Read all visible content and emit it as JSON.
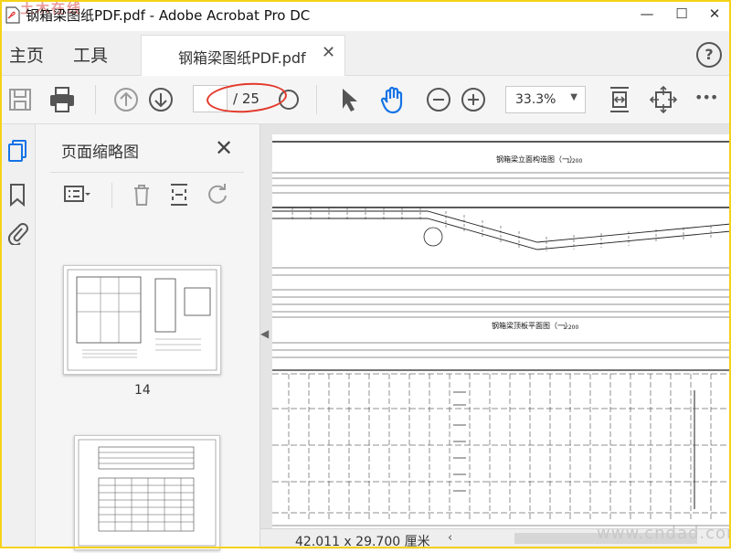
{
  "window": {
    "title": "钢箱梁图纸PDF.pdf - Adobe Acrobat Pro DC",
    "minimize_glyph": "—",
    "maximize_glyph": "☐",
    "close_glyph": "✕"
  },
  "menu": {
    "home": "主页",
    "tools": "工具"
  },
  "document_tab": {
    "label": "钢箱梁图纸PDF.pdf",
    "close_glyph": "✕"
  },
  "help": {
    "glyph": "?"
  },
  "toolbar": {
    "page_input_value": "",
    "page_total": "/ 25",
    "zoom_value": "33.3%",
    "zoom_caret": "▼",
    "more_glyph": "•••"
  },
  "annotation": {
    "color": "#e23a2c"
  },
  "thumbnail_panel": {
    "title": "页面缩略图",
    "close_glyph": "✕",
    "pages": [
      {
        "number": "14"
      }
    ],
    "scroll_up": "▲",
    "scroll_down": "▼"
  },
  "document": {
    "drawing_title_1": "钢箱梁立面构造图（一）",
    "drawing_scale_1": "1:200",
    "drawing_title_2": "钢箱梁顶板平面图（一）",
    "drawing_scale_2": "1:200"
  },
  "status_bar": {
    "dimensions": "42.011 x 29.700 厘米",
    "left_arrow": "‹"
  },
  "watermark": {
    "top_left": "土木在线",
    "bottom_right": "www.cndad.com"
  },
  "colors": {
    "accent_blue": "#1473e6",
    "icon_gray": "#555555",
    "disabled_gray": "#9a9a9a"
  }
}
